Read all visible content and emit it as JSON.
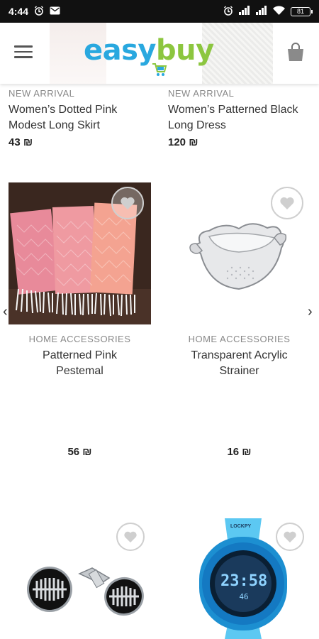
{
  "status_bar": {
    "time": "4:44",
    "left_icons": [
      "alarm-icon",
      "gmail-icon"
    ],
    "right_icons": [
      "alarm-icon",
      "signal-icon",
      "signal-icon",
      "wifi-icon",
      "battery-icon"
    ],
    "battery": "81"
  },
  "header": {
    "logo_part1": "easy",
    "logo_part2": "buy",
    "menu_icon": "hamburger-menu-icon",
    "cart_icon": "shopping-bag-icon",
    "colors": {
      "logo_blue": "#29a8df",
      "logo_green": "#8cc63f"
    }
  },
  "products_row1": [
    {
      "category": "NEW ARRIVAL",
      "name_line1": "Women’s Dotted Pink",
      "name_line2": "Modest Long Skirt",
      "price": "43 ₪"
    },
    {
      "category": "NEW ARRIVAL",
      "name_line1": "Women’s Patterned Black",
      "name_line2": "Long Dress",
      "price": "120 ₪"
    }
  ],
  "products_row2": [
    {
      "category": "HOME ACCESSORIES",
      "name_line1": "Patterned Pink",
      "name_line2": "Pestemal",
      "price": "56 ₪",
      "wishlist_icon": "heart-icon"
    },
    {
      "category": "HOME ACCESSORIES",
      "name_line1": "Transparent Acrylic",
      "name_line2": "Strainer",
      "price": "16 ₪",
      "wishlist_icon": "heart-icon"
    }
  ],
  "products_row3": [
    {
      "image": "cufflinks",
      "wishlist_icon": "heart-icon"
    },
    {
      "image": "kids-digital-watch",
      "watch_brand": "LOCKPY",
      "watch_time": "23:58",
      "watch_sub": "46",
      "wishlist_icon": "heart-icon"
    }
  ],
  "nav": {
    "prev_icon": "chevron-left-icon",
    "next_icon": "chevron-right-icon"
  }
}
